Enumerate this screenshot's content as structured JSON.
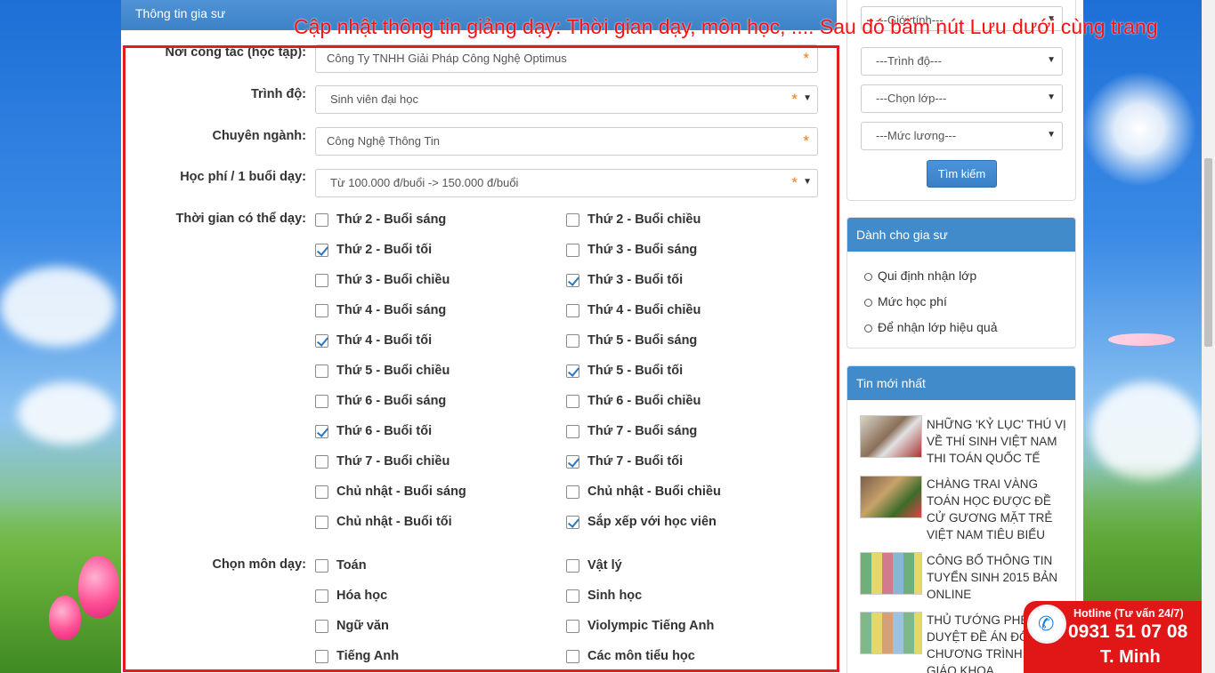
{
  "annotation": "Cập nhật thông tin giảng dạy: Thời gian dạy, môn học, .... Sau đó bấm nút Lưu dưới cùng trang",
  "panel": {
    "title": "Thông tin gia sư"
  },
  "form": {
    "workplace": {
      "label": "Nơi công tác (học tập):",
      "value": "Công Ty TNHH Giải Pháp Công Nghệ Optimus"
    },
    "level": {
      "label": "Trình độ:",
      "value": "Sinh viên đại học"
    },
    "major": {
      "label": "Chuyên ngành:",
      "value": "Công Nghệ Thông Tin"
    },
    "fee": {
      "label": "Học phí / 1 buổi dạy:",
      "value": "Từ 100.000 đ/buổi -> 150.000 đ/buổi"
    },
    "required_mark": "*",
    "schedule_label": "Thời gian có thể dạy:",
    "schedule": [
      {
        "label": "Thứ 2 - Buổi sáng",
        "checked": false
      },
      {
        "label": "Thứ 2 - Buổi chiều",
        "checked": false
      },
      {
        "label": "Thứ 2 - Buổi tối",
        "checked": true
      },
      {
        "label": "Thứ 3 - Buổi sáng",
        "checked": false
      },
      {
        "label": "Thứ 3 - Buổi chiều",
        "checked": false
      },
      {
        "label": "Thứ 3 - Buổi tối",
        "checked": true
      },
      {
        "label": "Thứ 4 - Buổi sáng",
        "checked": false
      },
      {
        "label": "Thứ 4 - Buổi chiều",
        "checked": false
      },
      {
        "label": "Thứ 4 - Buổi tối",
        "checked": true
      },
      {
        "label": "Thứ 5 - Buổi sáng",
        "checked": false
      },
      {
        "label": "Thứ 5 - Buổi chiều",
        "checked": false
      },
      {
        "label": "Thứ 5 - Buổi tối",
        "checked": true
      },
      {
        "label": "Thứ 6 - Buổi sáng",
        "checked": false
      },
      {
        "label": "Thứ 6 - Buổi chiều",
        "checked": false
      },
      {
        "label": "Thứ 6 - Buổi tối",
        "checked": true
      },
      {
        "label": "Thứ 7 - Buổi sáng",
        "checked": false
      },
      {
        "label": "Thứ 7 - Buổi chiều",
        "checked": false
      },
      {
        "label": "Thứ 7 - Buổi tối",
        "checked": true
      },
      {
        "label": "Chủ nhật - Buổi sáng",
        "checked": false
      },
      {
        "label": "Chủ nhật - Buổi chiều",
        "checked": false
      },
      {
        "label": "Chủ nhật - Buổi tối",
        "checked": false
      },
      {
        "label": "Sắp xếp với học viên",
        "checked": true
      }
    ],
    "subjects_label": "Chọn môn dạy:",
    "subjects": [
      {
        "label": "Toán",
        "checked": false
      },
      {
        "label": "Vật lý",
        "checked": false
      },
      {
        "label": "Hóa học",
        "checked": false
      },
      {
        "label": "Sinh học",
        "checked": false
      },
      {
        "label": "Ngữ văn",
        "checked": false
      },
      {
        "label": "Violympic Tiếng Anh",
        "checked": false
      },
      {
        "label": "Tiếng Anh",
        "checked": false
      },
      {
        "label": "Các môn tiểu học",
        "checked": false
      }
    ]
  },
  "sidebar": {
    "search": {
      "top_select": "---Giới tính---",
      "level_select": "---Trình độ---",
      "class_select": "---Chọn lớp---",
      "salary_select": "---Mức lương---",
      "button": "Tìm kiếm"
    },
    "tutor_box": {
      "title": "Dành cho gia sư",
      "links": [
        "Qui định nhận lớp",
        "Mức học phí",
        "Để nhận lớp hiệu quả"
      ]
    },
    "news_box": {
      "title": "Tin mới nhất",
      "items": [
        {
          "title": "NHỮNG 'KỶ LỤC' THÚ VỊ VỀ THÍ SINH VIỆT NAM THI TOÁN QUỐC TẾ"
        },
        {
          "title": "CHÀNG TRAI VÀNG TOÁN HỌC ĐƯỢC ĐỀ CỬ GƯƠNG MẶT TRẺ VIỆT NAM TIÊU BIỂU"
        },
        {
          "title": "CÔNG BỐ THÔNG TIN TUYỂN SINH 2015 BẢN ONLINE"
        },
        {
          "title": "THỦ TƯỚNG PHÊ DUYỆT ĐỀ ÁN ĐỔI MỚI CHƯƠNG TRÌNH, SÁCH GIÁO KHOA"
        }
      ]
    }
  },
  "hotline": {
    "title": "Hotline (Tư vấn 24/7)",
    "number": "0931 51 07 08",
    "name": "T. Minh",
    "icon": "phone-icon"
  },
  "colors": {
    "accent": "#428bca",
    "annotation": "#ff1010",
    "frame": "#e51c1c",
    "hotline": "#e11717",
    "required": "#f07b10"
  }
}
